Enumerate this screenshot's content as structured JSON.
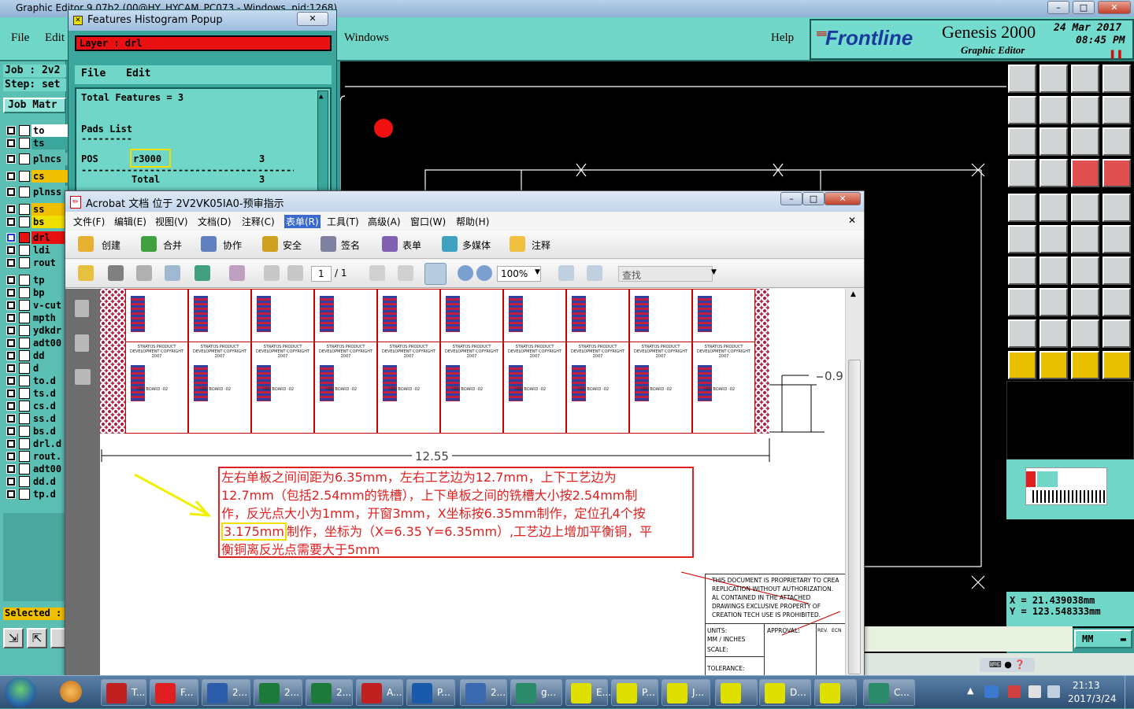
{
  "genesis": {
    "window_title": "Graphic Editor 9.07b2 (00@HY_HYCAM_PC073 - Windows, pid:1268)",
    "menu": {
      "file": "File",
      "edit": "Edit",
      "windows": "Windows",
      "help": "Help"
    },
    "brand": {
      "logo": "Frontline",
      "product": "Genesis 2000",
      "subtitle": "Graphic Editor",
      "date": "24 Mar 2017",
      "time": "08:45 PM"
    },
    "job_label": "Job : 2v2",
    "step_label": "Step: set",
    "job_matrix_label": "Job Matr",
    "selected_label": "Selected :",
    "layers": [
      {
        "name": "to",
        "color": "#ffffff"
      },
      {
        "name": "ts",
        "color": "#3aa69c"
      },
      {
        "name": "plncs",
        "color": "#5bbfb4"
      },
      {
        "name": "cs",
        "color": "#f0c000"
      },
      {
        "name": "plnss",
        "color": "#5bbfb4"
      },
      {
        "name": "ss",
        "color": "#f0c000"
      },
      {
        "name": "bs",
        "color": "#f0e000"
      },
      {
        "name": "drl",
        "color": "#e81010"
      },
      {
        "name": "ldi",
        "color": "#5bbfb4"
      },
      {
        "name": "rout",
        "color": "#5bbfb4"
      },
      {
        "name": "tp",
        "color": "#5bbfb4"
      },
      {
        "name": "bp",
        "color": "#5bbfb4"
      },
      {
        "name": "v-cut",
        "color": "#5bbfb4"
      },
      {
        "name": "mpth",
        "color": "#5bbfb4"
      },
      {
        "name": "ydkdr",
        "color": "#5bbfb4"
      },
      {
        "name": "adt00",
        "color": "#5bbfb4"
      },
      {
        "name": "dd",
        "color": "#5bbfb4"
      },
      {
        "name": "d",
        "color": "#5bbfb4"
      },
      {
        "name": "to.d",
        "color": "#5bbfb4"
      },
      {
        "name": "ts.d",
        "color": "#5bbfb4"
      },
      {
        "name": "cs.d",
        "color": "#5bbfb4"
      },
      {
        "name": "ss.d",
        "color": "#5bbfb4"
      },
      {
        "name": "bs.d",
        "color": "#5bbfb4"
      },
      {
        "name": "drl.d",
        "color": "#5bbfb4"
      },
      {
        "name": "rout.",
        "color": "#5bbfb4"
      },
      {
        "name": "adt00",
        "color": "#5bbfb4"
      },
      {
        "name": "dd.d",
        "color": "#5bbfb4"
      },
      {
        "name": "tp.d",
        "color": "#5bbfb4"
      }
    ],
    "coords": {
      "x": "X = 21.439038mm",
      "y": "Y = 123.548333mm"
    },
    "units": "MM"
  },
  "popup": {
    "title": "Features Histogram Popup",
    "layer": "Layer : drl",
    "menu": {
      "file": "File",
      "edit": "Edit"
    },
    "total_features": "Total Features = 3",
    "pads_list": "Pads List",
    "underline": "---------",
    "row_type": "POS",
    "row_symbol": "r3000",
    "row_count": "3",
    "divider": "---------------------------------------",
    "total_label": "Total",
    "total_count": "3"
  },
  "acrobat": {
    "title": "Acrobat 文档 位于 2V2VK05IA0-预审指示",
    "menu": [
      "文件(F)",
      "编辑(E)",
      "视图(V)",
      "文档(D)",
      "注释(C)",
      "表单(R)",
      "工具(T)",
      "高级(A)",
      "窗口(W)",
      "帮助(H)"
    ],
    "toolbar1": {
      "create": "创建",
      "combine": "合并",
      "collaborate": "协作",
      "secure": "安全",
      "sign": "签名",
      "forms": "表单",
      "multimedia": "多媒体",
      "comment": "注释"
    },
    "toolbar2": {
      "page": "1",
      "page_total": "/ 1",
      "zoom": "100%",
      "find": "查找"
    },
    "doc": {
      "dim_width": "12.55",
      "dim_height": "0.9",
      "board_header": "STRATOS PRODUCT DEVELOPMENT COPYRIGHT 2007",
      "board_label": "LED BOARD -02",
      "note_line1": "左右单板之间间距为6.35mm，左右工艺边为12.7mm，上下工艺边为",
      "note_line2": "12.7mm（包括2.54mm的铣槽），上下单板之间的铣槽大小按2.54mm制",
      "note_line3": "作，反光点大小为1mm，开窗3mm，X坐标按6.35mm制作，定位孔4个按",
      "note_highlight": "3.175mm",
      "note_line4_rest": "制作，坐标为（X=6.35 Y=6.35mm）,工艺边上增加平衡铜，平",
      "note_line5": "衡铜离反光点需要大于5mm",
      "legal": "THIS DOCUMENT IS PROPRIETARY TO CREA REPLICATION WITHOUT AUTHORIZATION. AL CONTAINED IN THE ATTACHED DRAWINGS EXCLUSIVE PROPERTY OF CREATION TECH USE IS PROHIBITED.",
      "units_label": "UNITS:",
      "units_value": "MM / INCHES",
      "scale_label": "SCALE:",
      "tolerance_label": "TOLERANCE:",
      "approval_label": "APPROVAL:",
      "rev_label": "REV.",
      "ecn_label": "ECN"
    }
  },
  "taskbar": {
    "items": [
      {
        "label": "T...",
        "color": "#c02020"
      },
      {
        "label": "F...",
        "color": "#e02020"
      },
      {
        "label": "2...",
        "color": "#2a5caa"
      },
      {
        "label": "2...",
        "color": "#1e7a3a"
      },
      {
        "label": "2...",
        "color": "#1e7a3a"
      },
      {
        "label": "A...",
        "color": "#c02020"
      },
      {
        "label": "P...",
        "color": "#1a5aaa"
      },
      {
        "label": "2...",
        "color": "#3a6ab0"
      },
      {
        "label": "g...",
        "color": "#2a8a6a"
      },
      {
        "label": "E...",
        "color": "#e0e000"
      },
      {
        "label": "P...",
        "color": "#e0e000"
      },
      {
        "label": "J...",
        "color": "#e0e000"
      },
      {
        "label": "",
        "color": "#e0e000"
      },
      {
        "label": "D...",
        "color": "#e0e000"
      },
      {
        "label": "",
        "color": "#e0e000"
      },
      {
        "label": "C...",
        "color": "#2a8a6a"
      }
    ],
    "clock_time": "21:13",
    "clock_date": "2017/3/24"
  }
}
